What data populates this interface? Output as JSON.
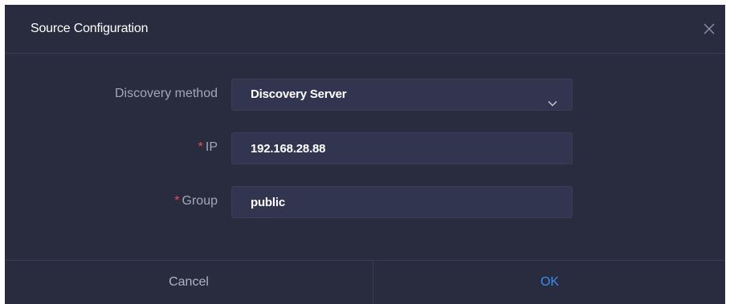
{
  "dialog": {
    "title": "Source Configuration",
    "close_icon": "close-icon"
  },
  "form": {
    "discovery_method": {
      "label": "Discovery method",
      "value": "Discovery Server",
      "icon": "chevron-down-icon"
    },
    "ip": {
      "required_mark": "*",
      "label": "IP",
      "value": "192.168.28.88"
    },
    "group": {
      "required_mark": "*",
      "label": "Group",
      "value": "public"
    }
  },
  "footer": {
    "cancel_label": "Cancel",
    "ok_label": "OK"
  },
  "colors": {
    "background": "#292b3f",
    "field_background": "#323550",
    "label": "#a3a6b8",
    "required": "#e2524e",
    "primary": "#3d8cf0"
  }
}
